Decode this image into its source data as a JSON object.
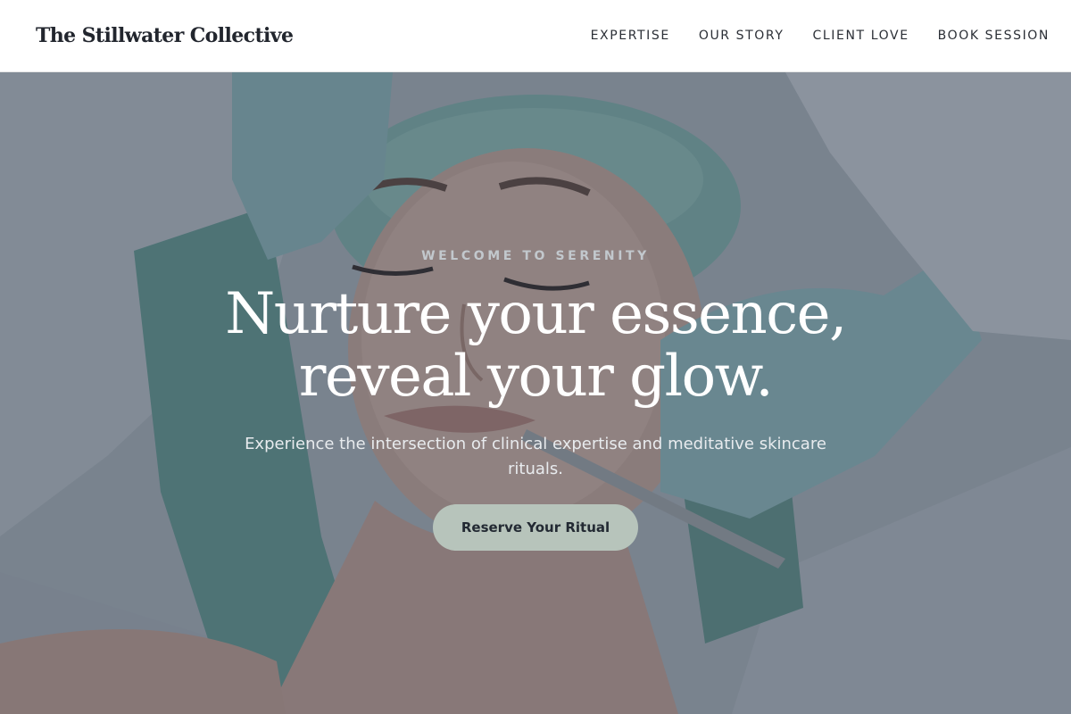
{
  "nav": {
    "brand": "The Stillwater Collective",
    "links": [
      "EXPERTISE",
      "OUR STORY",
      "CLIENT LOVE",
      "BOOK SESSION"
    ]
  },
  "hero": {
    "eyebrow": "WELCOME TO SERENITY",
    "headline_line1": "Nurture your essence,",
    "headline_line2": "reveal your glow.",
    "subheadline": "Experience the intersection of clinical expertise and meditative skincare rituals.",
    "cta_label": "Reserve Your Ritual"
  },
  "colors": {
    "nav_background": "#ffffff",
    "brand_text": "#22262e",
    "overlay": "#374252",
    "cta_background": "#b7c4bb",
    "cta_text": "#232a33"
  }
}
